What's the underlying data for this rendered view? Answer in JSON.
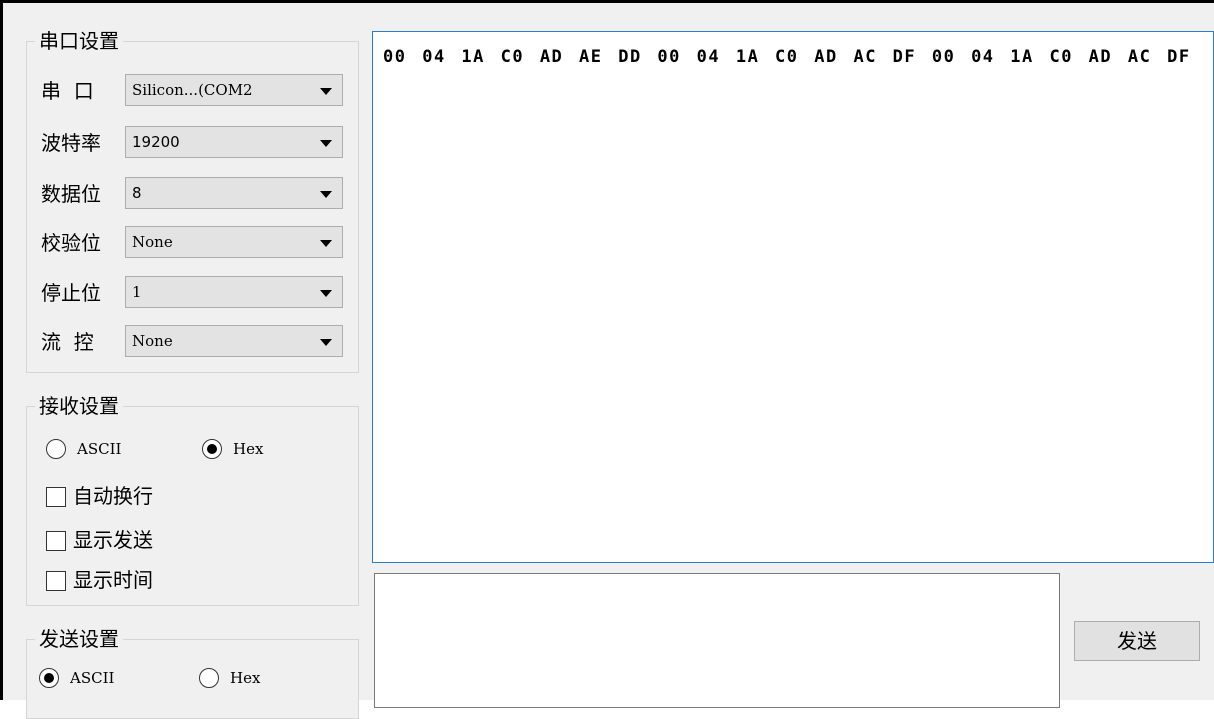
{
  "serial_settings": {
    "title": "串口设置",
    "rows": [
      {
        "label": "串  口",
        "value": "Silicon...(COM2"
      },
      {
        "label": "波特率",
        "value": "19200"
      },
      {
        "label": "数据位",
        "value": "8"
      },
      {
        "label": "校验位",
        "value": "None"
      },
      {
        "label": "停止位",
        "value": "1"
      },
      {
        "label": "流  控",
        "value": "None"
      }
    ]
  },
  "receive_settings": {
    "title": "接收设置",
    "ascii_label": "ASCII",
    "hex_label": "Hex",
    "selected": "Hex",
    "checkboxes": [
      {
        "label": "自动换行",
        "checked": false
      },
      {
        "label": "显示发送",
        "checked": false
      },
      {
        "label": "显示时间",
        "checked": false
      }
    ]
  },
  "send_settings": {
    "title": "发送设置",
    "ascii_label": "ASCII",
    "hex_label": "Hex",
    "selected": "ASCII"
  },
  "receive_area": {
    "content": "00 04 1A C0 AD AE DD 00 04 1A C0 AD AC DF 00 04 1A C0 AD AC DF"
  },
  "send_area": {
    "content": ""
  },
  "send_button": {
    "label": "发送"
  },
  "colors": {
    "focus_border": "#2a7bd1",
    "panel_bg": "#f0f0f0"
  }
}
